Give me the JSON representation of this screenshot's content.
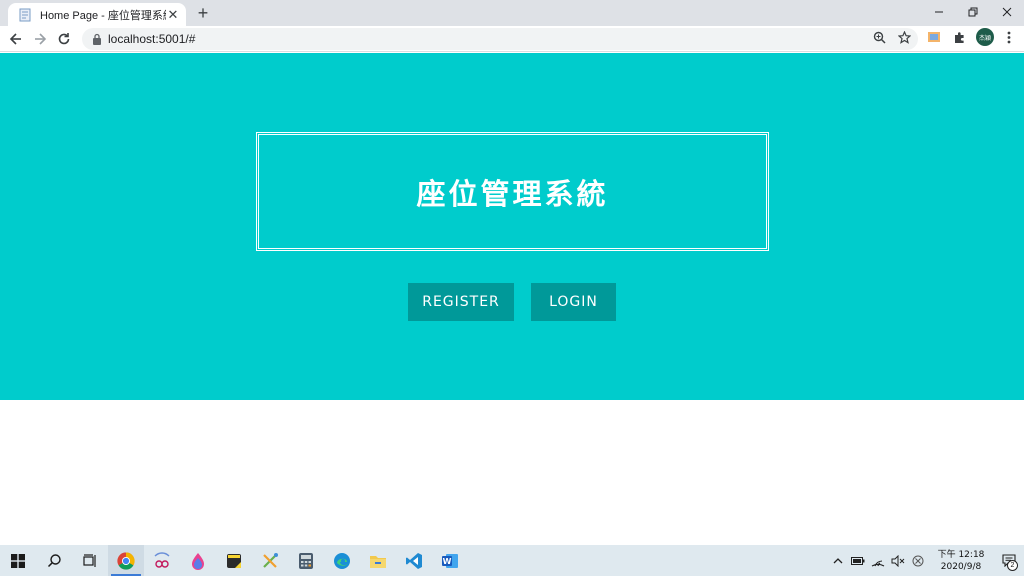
{
  "browser": {
    "tab_title": "Home Page - 座位管理系統",
    "url": "localhost:5001/#",
    "profile_initials": "杰穎"
  },
  "page": {
    "title": "座位管理系統",
    "register_label": "REGISTER",
    "login_label": "LOGIN"
  },
  "colors": {
    "hero_bg": "#00cccc",
    "button_bg": "#009999",
    "text": "#ffffff"
  },
  "taskbar": {
    "apps": [
      "windows-start-icon",
      "search-icon",
      "task-view-icon",
      "chrome-icon",
      "snipping-icon",
      "paint-icon",
      "sticky-notes-icon",
      "tools-icon",
      "calculator-icon",
      "edge-icon",
      "file-explorer-icon",
      "vscode-icon",
      "word-icon"
    ],
    "clock_time": "下午 12:18",
    "clock_date": "2020/9/8",
    "notification_count": "2"
  }
}
